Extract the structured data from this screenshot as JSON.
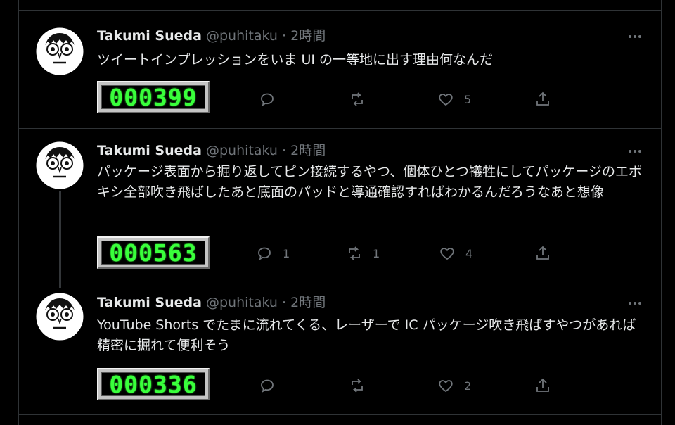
{
  "tweets": [
    {
      "name": "Takumi Sueda",
      "handle": "@puhitaku",
      "time": "2時間",
      "text": "ツイートインプレッションをいま UI の一等地に出す理由何なんだ",
      "impressions": "000399",
      "reply_count": "",
      "retweet_count": "",
      "like_count": "5"
    },
    {
      "name": "Takumi Sueda",
      "handle": "@puhitaku",
      "time": "2時間",
      "text": "パッケージ表面から掘り返してピン接続するやつ、個体ひとつ犠牲にしてパッケージのエポキシ全部吹き飛ばしたあと底面のパッドと導通確認すればわかるんだろうなあと想像",
      "impressions": "000563",
      "reply_count": "1",
      "retweet_count": "1",
      "like_count": "4"
    },
    {
      "name": "Takumi Sueda",
      "handle": "@puhitaku",
      "time": "2時間",
      "text": "YouTube Shorts でたまに流れてくる、レーザーで IC パッケージ吹き飛ばすやつがあれば精密に掘れて便利そう",
      "impressions": "000336",
      "reply_count": "",
      "retweet_count": "",
      "like_count": "2"
    }
  ],
  "separator": "·",
  "icons": {
    "avatar": "cartoon-face-avatar",
    "more": "more-icon",
    "reply": "reply-icon",
    "retweet": "retweet-icon",
    "like": "heart-icon",
    "share": "share-icon"
  },
  "colors": {
    "background": "#000000",
    "text": "#e7e9ea",
    "muted": "#71767b",
    "border": "#2f3336",
    "counter_digits": "#39ff3b"
  }
}
